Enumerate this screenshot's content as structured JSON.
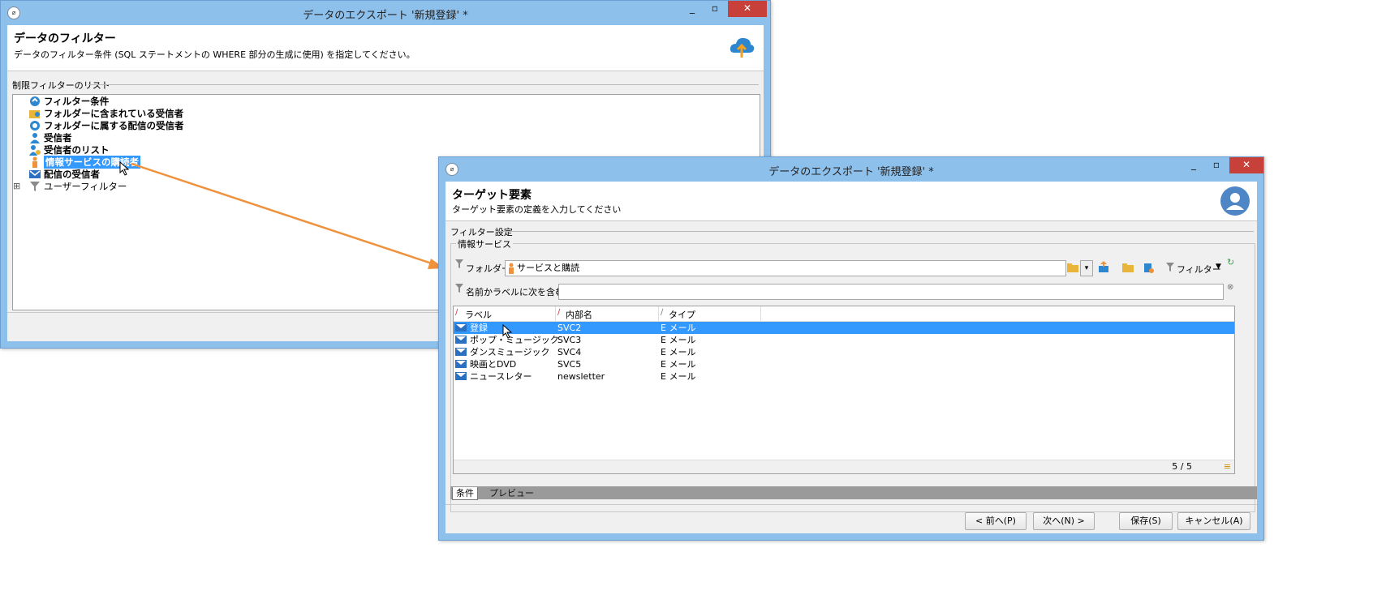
{
  "back_window": {
    "title": "データのエクスポート '新規登録' *",
    "header_title": "データのフィルター",
    "header_subtitle": "データのフィルター条件 (SQL ステートメントの WHERE 部分の生成に使用) を指定してください。",
    "section_label": "制限フィルターのリスト",
    "tree_items": [
      {
        "label": "フィルター条件",
        "icon": "filter-condition-icon"
      },
      {
        "label": "フォルダーに含まれている受信者",
        "icon": "folder-recipient-icon"
      },
      {
        "label": "フォルダーに属する配信の受信者",
        "icon": "delivery-recipient-icon"
      },
      {
        "label": "受信者",
        "icon": "recipient-icon"
      },
      {
        "label": "受信者のリスト",
        "icon": "recipient-list-icon"
      },
      {
        "label": "情報サービスの購読者",
        "icon": "subscriber-icon"
      },
      {
        "label": "配信の受信者",
        "icon": "mail-icon"
      },
      {
        "label": "ユーザーフィルター",
        "icon": "funnel-icon"
      }
    ],
    "tree_expander": "⊞"
  },
  "front_window": {
    "title": "データのエクスポート '新規登録' *",
    "header_title": "ターゲット要素",
    "header_subtitle": "ターゲット要素の定義を入力してください",
    "section_filter_settings": "フィルター設定",
    "section_info_service": "情報サービス",
    "folder_label": "フォルダー:",
    "folder_value": "サービスと購読",
    "filter_menu_label": "フィルター",
    "search_label": "名前かラベルに次を含む:",
    "search_value": "",
    "grid": {
      "columns": [
        "ラベル",
        "内部名",
        "タイプ"
      ],
      "rows": [
        {
          "label": "登録",
          "internal": "SVC2",
          "type": "E メール",
          "selected": true
        },
        {
          "label": "ポップ・ミュージック",
          "internal": "SVC3",
          "type": "E メール",
          "selected": false
        },
        {
          "label": "ダンスミュージック",
          "internal": "SVC4",
          "type": "E メール",
          "selected": false
        },
        {
          "label": "映画とDVD",
          "internal": "SVC5",
          "type": "E メール",
          "selected": false
        },
        {
          "label": "ニュースレター",
          "internal": "newsletter",
          "type": "E メール",
          "selected": false
        }
      ],
      "count": "5 / 5"
    },
    "tabs": [
      "条件",
      "プレビュー"
    ],
    "buttons": {
      "prev": "< 前へ(P)",
      "next": "次へ(N) >",
      "save": "保存(S)",
      "cancel": "キャンセル(A)"
    }
  },
  "colors": {
    "accent": "#3399ff",
    "arrow": "#f0913c",
    "titlebar": "#8ec0ec",
    "close": "#c7403a"
  }
}
